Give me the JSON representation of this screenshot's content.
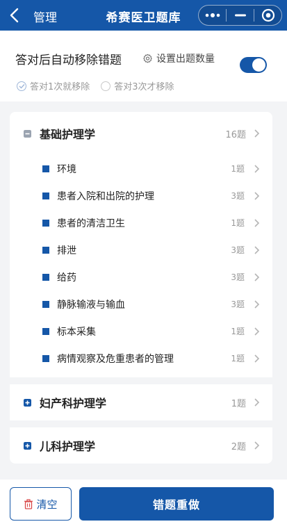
{
  "header": {
    "back_label": "管理",
    "title": "希赛医卫题库"
  },
  "settings": {
    "auto_remove_label": "答对后自动移除错题",
    "set_count_label": "设置出题数量",
    "toggle_on": true,
    "radio_options": [
      {
        "label": "答对1次就移除",
        "checked": true
      },
      {
        "label": "答对3次才移除",
        "checked": false
      }
    ]
  },
  "sections": [
    {
      "title": "基础护理学",
      "count": "16题",
      "expanded": true,
      "items": [
        {
          "label": "环境",
          "count": "1题"
        },
        {
          "label": "患者入院和出院的护理",
          "count": "3题"
        },
        {
          "label": "患者的清洁卫生",
          "count": "1题"
        },
        {
          "label": "排泄",
          "count": "3题"
        },
        {
          "label": "给药",
          "count": "3题"
        },
        {
          "label": "静脉输液与输血",
          "count": "3题"
        },
        {
          "label": "标本采集",
          "count": "1题"
        },
        {
          "label": "病情观察及危重患者的管理",
          "count": "1题"
        }
      ]
    },
    {
      "title": "妇产科护理学",
      "count": "1题",
      "expanded": false,
      "items": []
    },
    {
      "title": "儿科护理学",
      "count": "2题",
      "expanded": false,
      "items": []
    }
  ],
  "footer": {
    "clear_label": "清空",
    "redo_label": "错题重做"
  },
  "colors": {
    "primary": "#1557a8",
    "muted": "#999999"
  }
}
